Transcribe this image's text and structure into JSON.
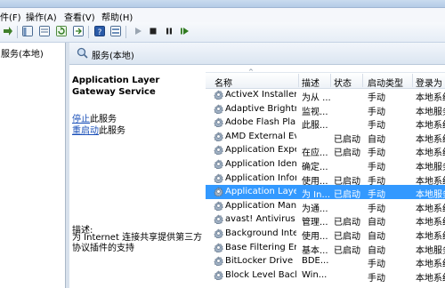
{
  "menu": [
    "件(F)",
    "操作(A)",
    "查看(V)",
    "帮助(H)"
  ],
  "tree": {
    "root_label": "服务(本地)"
  },
  "header": {
    "title": "服务(本地)"
  },
  "detail": {
    "service_name": "Application Layer Gateway Service",
    "stop_link": "停止",
    "stop_suffix": "此服务",
    "restart_link": "重启动",
    "restart_suffix": "此服务",
    "description_label": "描述:",
    "description_text": "为 Internet 连接共享提供第三方协议插件的支持"
  },
  "columns": [
    "名称",
    "描述",
    "状态",
    "启动类型",
    "登录为"
  ],
  "sort_indicator": "^",
  "rows": [
    {
      "name": "ActiveX Installer ...",
      "desc": "为从 ...",
      "status": "",
      "startup": "手动",
      "logon": "本地系统"
    },
    {
      "name": "Adaptive Brightn...",
      "desc": "监视...",
      "status": "",
      "startup": "手动",
      "logon": "本地服务"
    },
    {
      "name": "Adobe Flash Pla...",
      "desc": "此服...",
      "status": "",
      "startup": "手动",
      "logon": "本地系统"
    },
    {
      "name": "AMD External Ev...",
      "desc": "",
      "status": "已启动",
      "startup": "自动",
      "logon": "本地系统"
    },
    {
      "name": "Application Expe...",
      "desc": "在应...",
      "status": "已启动",
      "startup": "手动",
      "logon": "本地系统"
    },
    {
      "name": "Application Iden...",
      "desc": "确定...",
      "status": "",
      "startup": "手动",
      "logon": "本地服务"
    },
    {
      "name": "Application Infor...",
      "desc": "使用...",
      "status": "已启动",
      "startup": "手动",
      "logon": "本地系统"
    },
    {
      "name": "Application Laye...",
      "desc": "为 In...",
      "status": "已启动",
      "startup": "手动",
      "logon": "本地服务"
    },
    {
      "name": "Application Man...",
      "desc": "为通...",
      "status": "",
      "startup": "手动",
      "logon": "本地系统"
    },
    {
      "name": "avast! Antivirus",
      "desc": "管理...",
      "status": "已启动",
      "startup": "自动",
      "logon": "本地系统"
    },
    {
      "name": "Background Inte...",
      "desc": "使用...",
      "status": "已启动",
      "startup": "自动",
      "logon": "本地系统"
    },
    {
      "name": "Base Filtering En...",
      "desc": "基本...",
      "status": "已启动",
      "startup": "自动",
      "logon": "本地服务"
    },
    {
      "name": "BitLocker Drive ...",
      "desc": "BDE...",
      "status": "",
      "startup": "手动",
      "logon": "本地系统"
    },
    {
      "name": "Block Level Back...",
      "desc": "Win...",
      "status": "",
      "startup": "手动",
      "logon": "本地系统"
    }
  ],
  "selected_row_index": 7,
  "colors": {
    "selection": "#3399ff",
    "link": "#1a4fb8"
  }
}
